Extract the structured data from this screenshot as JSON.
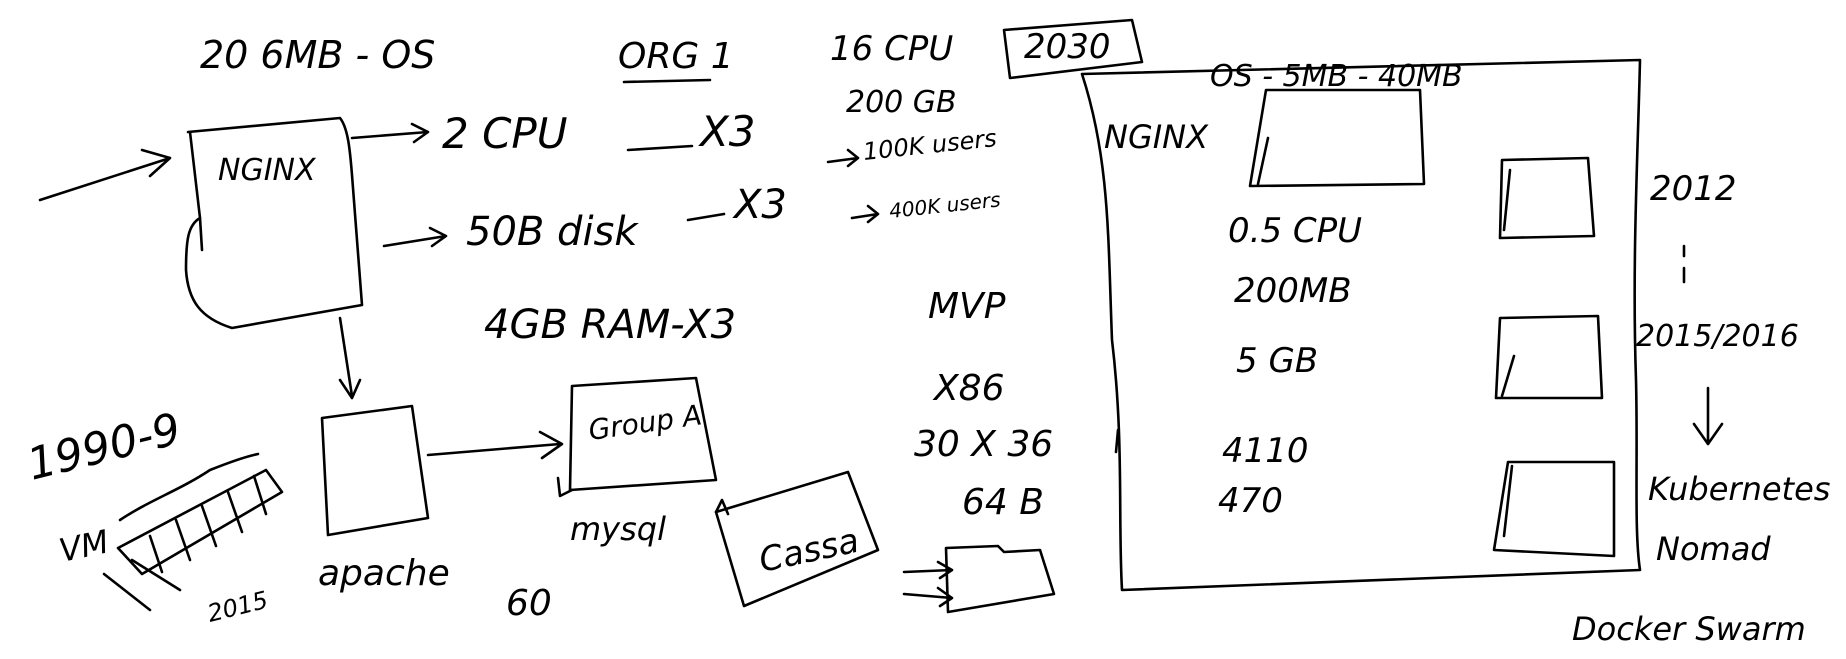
{
  "board": {
    "background": "#ffffff",
    "ink": "#000000"
  },
  "labels": {
    "os_size": "20 6MB - OS",
    "org": "ORG 1",
    "nginx_left": "NGINX",
    "cpu2": "2 CPU",
    "times3_cpu": "X3",
    "disk": "50B disk",
    "times3_disk": "X3",
    "ram": "4GB RAM-X3",
    "cpu16": "16 CPU",
    "gb200": "200 GB",
    "users100k": "100K users",
    "users400k": "400K users",
    "year2030": "2030",
    "mvp": "MVP",
    "x86": "X86",
    "x3036": "30 X 36",
    "gb64": "64 B",
    "year1990": "1990-9",
    "vm": "VM",
    "year2015": "2015",
    "apache": "apache",
    "group_a": "Group A",
    "mysql": "mysql",
    "sixty": "60",
    "cassandra": "Cassa",
    "os_small": "OS - 5MB - 40MB",
    "nginx_right": "NGINX",
    "cpu05": "0.5 CPU",
    "mb200": "200MB",
    "gb5": "5 GB",
    "n4110": "4110",
    "n470": "470",
    "year2012": "2012",
    "year2015_2016": "2015/2016",
    "kubernetes": "Kubernetes",
    "nomad": "Nomad",
    "docker_swarm": "Docker Swarm"
  }
}
